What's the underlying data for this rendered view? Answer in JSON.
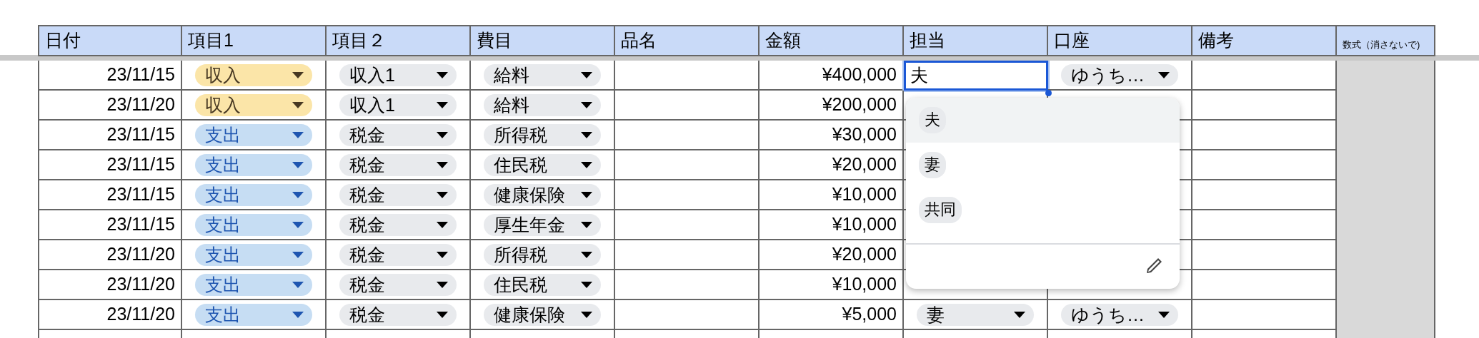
{
  "columns": [
    {
      "label": "日付",
      "kind": "normal"
    },
    {
      "label": "項目1",
      "kind": "normal"
    },
    {
      "label": "項目２",
      "kind": "normal"
    },
    {
      "label": "費目",
      "kind": "normal"
    },
    {
      "label": "品名",
      "kind": "normal"
    },
    {
      "label": "金額",
      "kind": "normal"
    },
    {
      "label": "担当",
      "kind": "normal"
    },
    {
      "label": "口座",
      "kind": "normal"
    },
    {
      "label": "備考",
      "kind": "normal"
    },
    {
      "label": "数式（消さないで)",
      "kind": "small"
    }
  ],
  "rows": [
    {
      "date": "23/11/15",
      "item1": {
        "text": "収入",
        "kind": "income"
      },
      "item2": "収入1",
      "expense": "給料",
      "amount": "¥400,000",
      "owner": {
        "text": "夫",
        "editing": true
      },
      "account": "ゆうち…"
    },
    {
      "date": "23/11/20",
      "item1": {
        "text": "収入",
        "kind": "income"
      },
      "item2": "収入1",
      "expense": "給料",
      "amount": "¥200,000"
    },
    {
      "date": "23/11/15",
      "item1": {
        "text": "支出",
        "kind": "expense"
      },
      "item2": "税金",
      "expense": "所得税",
      "amount": "¥30,000"
    },
    {
      "date": "23/11/15",
      "item1": {
        "text": "支出",
        "kind": "expense"
      },
      "item2": "税金",
      "expense": "住民税",
      "amount": "¥20,000"
    },
    {
      "date": "23/11/15",
      "item1": {
        "text": "支出",
        "kind": "expense"
      },
      "item2": "税金",
      "expense": "健康保険",
      "amount": "¥10,000"
    },
    {
      "date": "23/11/15",
      "item1": {
        "text": "支出",
        "kind": "expense"
      },
      "item2": "税金",
      "expense": "厚生年金",
      "amount": "¥10,000"
    },
    {
      "date": "23/11/20",
      "item1": {
        "text": "支出",
        "kind": "expense"
      },
      "item2": "税金",
      "expense": "所得税",
      "amount": "¥20,000"
    },
    {
      "date": "23/11/20",
      "item1": {
        "text": "支出",
        "kind": "expense"
      },
      "item2": "税金",
      "expense": "住民税",
      "amount": "¥10,000"
    },
    {
      "date": "23/11/20",
      "item1": {
        "text": "支出",
        "kind": "expense"
      },
      "item2": "税金",
      "expense": "健康保険",
      "amount": "¥5,000",
      "owner": {
        "text": "妻",
        "editing": false
      },
      "account": "ゆうち…"
    }
  ],
  "dropdown": {
    "options": [
      {
        "label": "夫",
        "selected": true
      },
      {
        "label": "妻",
        "selected": false
      },
      {
        "label": "共同",
        "selected": false
      }
    ]
  }
}
